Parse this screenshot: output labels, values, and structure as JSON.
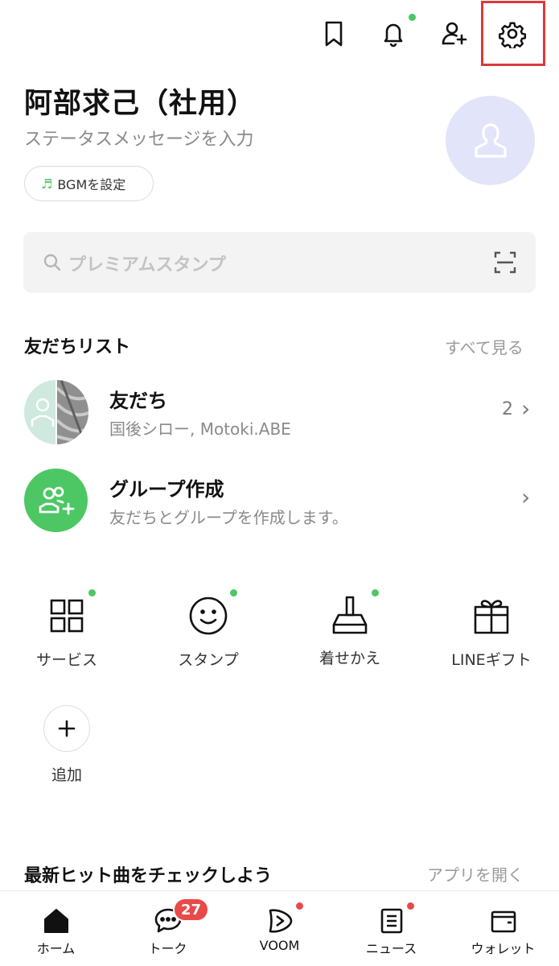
{
  "header": {
    "icons": [
      "bookmark-icon",
      "bell-icon",
      "add-friend-icon",
      "settings-icon"
    ]
  },
  "profile": {
    "name": "阿部求己（社用）",
    "status_placeholder": "ステータスメッセージを入力",
    "bgm_label": "BGMを設定"
  },
  "search": {
    "placeholder": "プレミアムスタンプ"
  },
  "friends_section": {
    "title": "友だちリスト",
    "see_all": "すべて見る",
    "friends": {
      "title": "友だち",
      "subtitle": "国後シロー, Motoki.ABE",
      "count": "2"
    },
    "group": {
      "title": "グループ作成",
      "subtitle": "友だちとグループを作成します。"
    }
  },
  "services": {
    "items": [
      {
        "label": "サービス",
        "icon": "grid-icon"
      },
      {
        "label": "スタンプ",
        "icon": "smiley-icon"
      },
      {
        "label": "着せかえ",
        "icon": "brush-icon"
      },
      {
        "label": "LINEギフト",
        "icon": "gift-icon"
      }
    ],
    "add_label": "追加"
  },
  "music": {
    "title": "最新ヒット曲をチェックしよう",
    "open_app": "アプリを開く"
  },
  "bottom_nav": {
    "items": [
      {
        "label": "ホーム",
        "icon": "home-icon"
      },
      {
        "label": "トーク",
        "icon": "chat-icon",
        "badge": "27"
      },
      {
        "label": "VOOM",
        "icon": "voom-icon"
      },
      {
        "label": "ニュース",
        "icon": "news-icon"
      },
      {
        "label": "ウォレット",
        "icon": "wallet-icon"
      }
    ]
  },
  "colors": {
    "accent_green": "#4cc764",
    "badge_red": "#e84a4a",
    "avatar_bg": "#e2e4fa",
    "highlight": "#d93a3a"
  }
}
